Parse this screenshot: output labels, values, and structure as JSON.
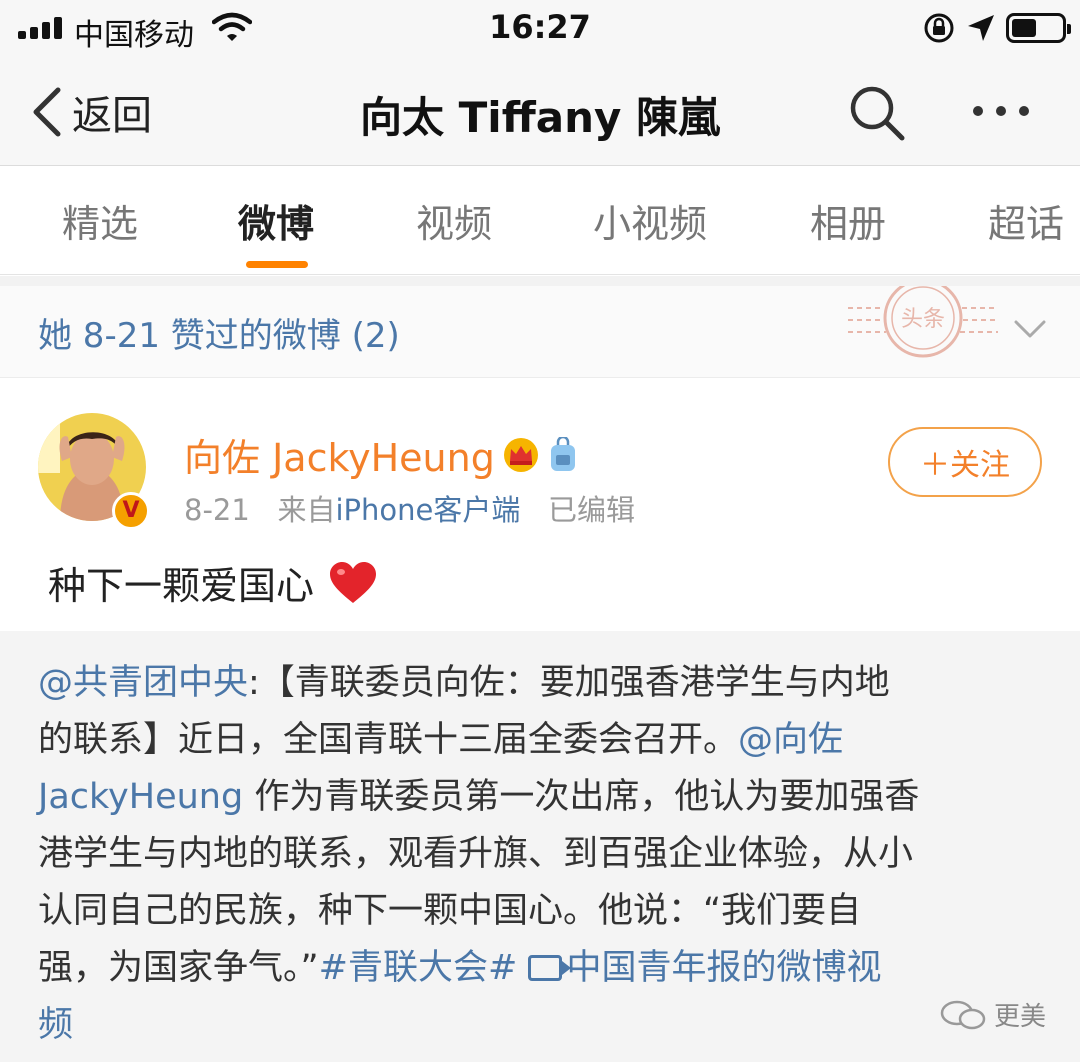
{
  "status_bar": {
    "carrier": "中国移动",
    "time": "16:27"
  },
  "nav": {
    "back_label": "返回",
    "title": "向太 Tiffany 陳嵐"
  },
  "tabs": [
    "精选",
    "微博",
    "视频",
    "小视频",
    "相册",
    "超话"
  ],
  "active_tab": "微博",
  "liked_header": {
    "text": "她 8-21 赞过的微博 (2)",
    "stamp_text": "头条"
  },
  "post": {
    "username": "向佐 JackyHeung",
    "date": "8-21",
    "source_prefix": "来自",
    "source": "iPhone客户端",
    "edited": "已编辑",
    "follow_label": "＋关注",
    "verified_badge": "V",
    "text": "种下一颗爱国心"
  },
  "repost": {
    "mention_1": "@共青团中央",
    "line1_rest": ":【青联委员向佐：要加强香港学生与内地",
    "line2_text": "的联系】近日，全国青联十三届全委会召开。",
    "mention_2a": "@向佐",
    "mention_2b": "JackyHeung",
    "line3_rest": " 作为青联委员第一次出席，他认为要加强香",
    "line4": "港学生与内地的联系，观看升旗、到百强企业体验，从小",
    "line5": "认同自己的民族，种下一颗中国心。他说：“我们要自",
    "line6_text": "强，为国家争气。”",
    "hashtag": "#青联大会#",
    "video_link_a": "中国青年报的微博视",
    "video_link_b": "频"
  },
  "watermark": "更美",
  "colors": {
    "accent_orange": "#f3802a",
    "link_blue": "#4b77a8",
    "tab_indicator": "#ff8200"
  }
}
